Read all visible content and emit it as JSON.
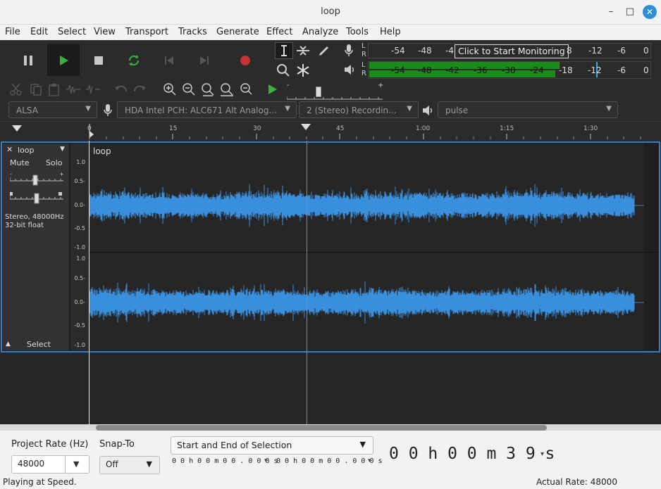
{
  "window": {
    "title": "loop",
    "minimize": "–",
    "maximize": "□",
    "close": "✕"
  },
  "menu": [
    "File",
    "Edit",
    "Select",
    "View",
    "Transport",
    "Tracks",
    "Generate",
    "Effect",
    "Analyze",
    "Tools",
    "Help"
  ],
  "meters": {
    "rec_scale": [
      "-54",
      "-48",
      "-4",
      "8",
      "-12",
      "-6",
      "0"
    ],
    "rec_tooltip": "Click to Start Monitoring",
    "play_scale": [
      "-54",
      "-48",
      "-42",
      "-36",
      "-30",
      "-24",
      "-18",
      "-12",
      "-6",
      "0"
    ],
    "lr": [
      "L",
      "R"
    ]
  },
  "speed_slider": {
    "minus": "-",
    "plus": "+"
  },
  "device": {
    "host": "ALSA",
    "recording_device": "HDA Intel PCH: ALC671 Alt Analog...",
    "channels": "2 (Stereo) Recordin...",
    "playback_device": "pulse"
  },
  "ruler": {
    "labels": [
      "0",
      "15",
      "30",
      "45",
      "1:00",
      "1:15",
      "1:30"
    ]
  },
  "track": {
    "name": "loop",
    "mute": "Mute",
    "solo": "Solo",
    "info_line1": "Stereo, 48000Hz",
    "info_line2": "32-bit float",
    "select": "Select",
    "clip_name": "loop",
    "scale_ch1": [
      "1.0",
      "0.5-",
      "0.0-",
      "-0.5",
      "-1.0"
    ],
    "scale_ch2": [
      "1.0",
      "0.5-",
      "0.0-",
      "-0.5",
      "-1.0"
    ]
  },
  "bottom": {
    "project_rate_label": "Project Rate (Hz)",
    "project_rate_value": "48000",
    "snap_to_label": "Snap-To",
    "snap_to_value": "Off",
    "selection_mode": "Start and End of Selection",
    "sel_start": "0 0 h 0 0 m 0 0 . 0 0 0 s",
    "sel_end": "0 0 h 0 0 m 0 0 . 0 0 0 s",
    "audio_position": "0 0 h 0 0 m 3 9 s"
  },
  "status": {
    "left": "Playing at Speed.",
    "right": "Actual Rate: 48000"
  }
}
